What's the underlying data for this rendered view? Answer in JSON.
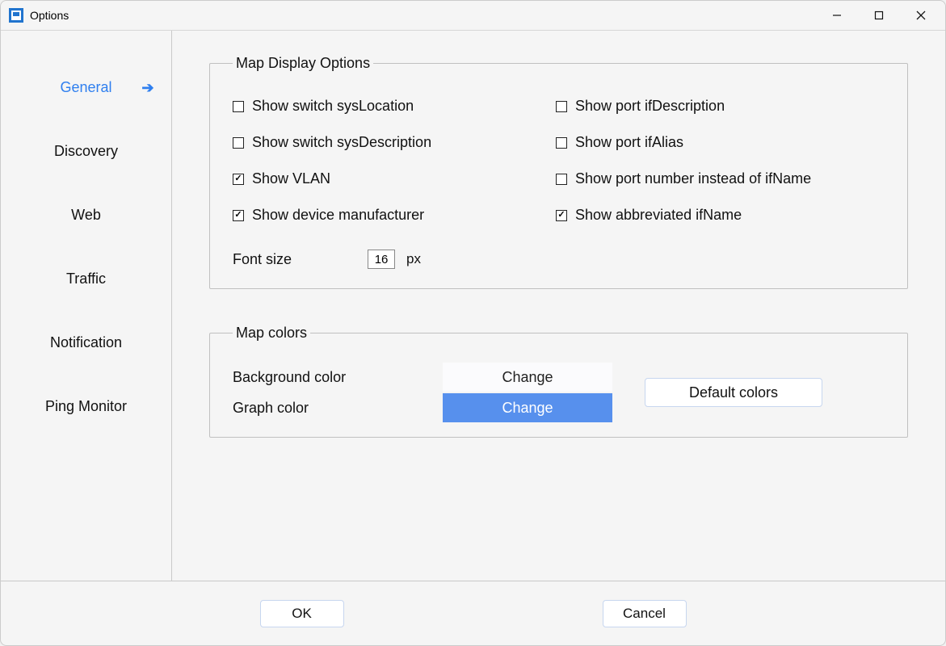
{
  "window": {
    "title": "Options"
  },
  "sidebar": {
    "items": [
      {
        "label": "General",
        "active": true
      },
      {
        "label": "Discovery"
      },
      {
        "label": "Web"
      },
      {
        "label": "Traffic"
      },
      {
        "label": "Notification"
      },
      {
        "label": "Ping Monitor"
      }
    ]
  },
  "groups": {
    "map_display": {
      "legend": "Map Display Options",
      "checkboxes": {
        "show_switch_syslocation": {
          "label": "Show switch sysLocation",
          "checked": false
        },
        "show_port_ifdescription": {
          "label": "Show port ifDescription",
          "checked": false
        },
        "show_switch_sysdescription": {
          "label": "Show switch sysDescription",
          "checked": false
        },
        "show_port_ifalias": {
          "label": "Show port ifAlias",
          "checked": false
        },
        "show_vlan": {
          "label": "Show VLAN",
          "checked": true
        },
        "show_port_number": {
          "label": "Show port number instead of ifName",
          "checked": false
        },
        "show_device_manufacturer": {
          "label": "Show device manufacturer",
          "checked": true
        },
        "show_abbrev_ifname": {
          "label": "Show abbreviated ifName",
          "checked": true
        }
      },
      "font_size": {
        "label": "Font size",
        "value": "16",
        "unit": "px"
      }
    },
    "map_colors": {
      "legend": "Map colors",
      "rows": {
        "background": {
          "label": "Background color",
          "button": "Change"
        },
        "graph": {
          "label": "Graph color",
          "button": "Change"
        }
      },
      "default_button": "Default colors"
    }
  },
  "footer": {
    "ok": "OK",
    "cancel": "Cancel"
  }
}
